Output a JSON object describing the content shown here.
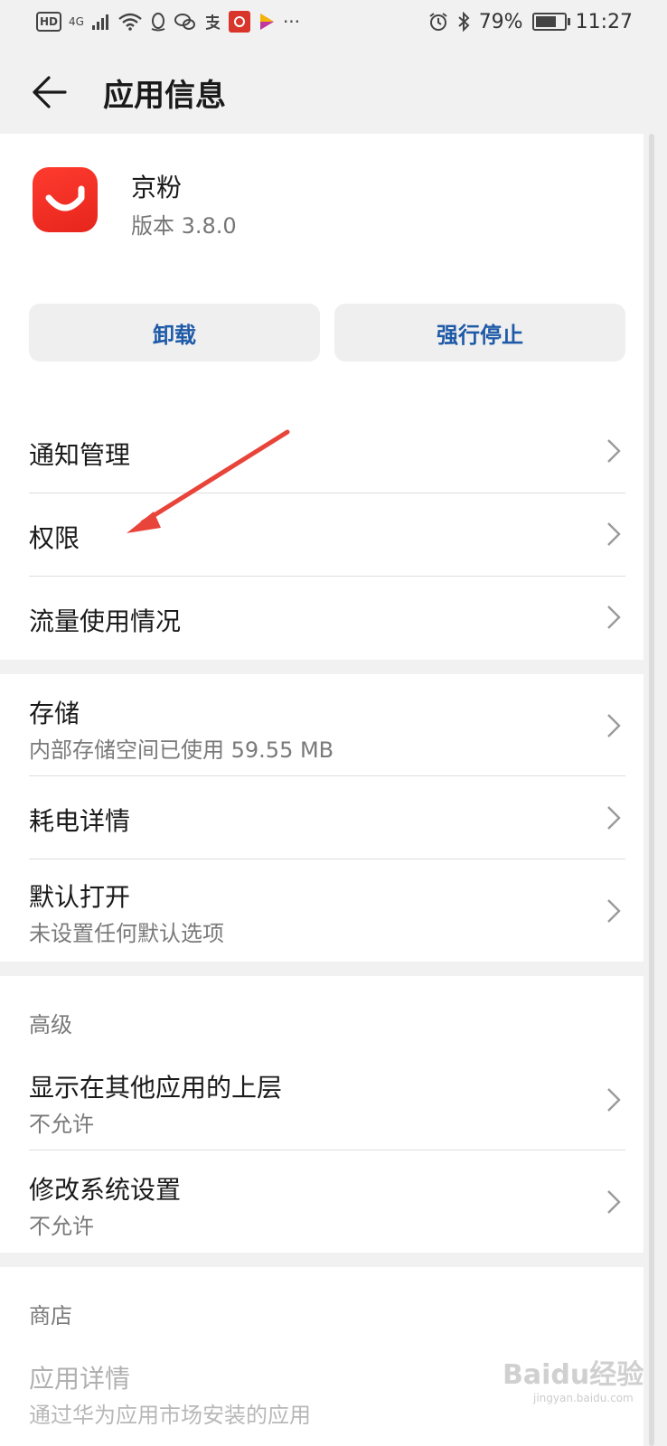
{
  "status_bar": {
    "network_badge": "HD",
    "network_type": "4G",
    "battery": "79%",
    "battery_level": 0.79,
    "time": "11:27",
    "more": "···"
  },
  "header": {
    "title": "应用信息"
  },
  "app": {
    "name": "京粉",
    "version": "版本 3.8.0"
  },
  "buttons": {
    "uninstall": "卸载",
    "force_stop": "强行停止"
  },
  "group1": [
    {
      "title": "通知管理"
    },
    {
      "title": "权限"
    },
    {
      "title": "流量使用情况"
    }
  ],
  "group2": [
    {
      "title": "存储",
      "subtitle": "内部存储空间已使用 59.55 MB"
    },
    {
      "title": "耗电详情"
    },
    {
      "title": "默认打开",
      "subtitle": "未设置任何默认选项"
    }
  ],
  "advanced": {
    "header": "高级",
    "items": [
      {
        "title": "显示在其他应用的上层",
        "subtitle": "不允许"
      },
      {
        "title": "修改系统设置",
        "subtitle": "不允许"
      }
    ]
  },
  "store": {
    "header": "商店",
    "items": [
      {
        "title": "应用详情",
        "subtitle": "通过华为应用市场安装的应用"
      }
    ]
  },
  "watermark": {
    "text": "Baidu经验",
    "url": "jingyan.baidu.com"
  },
  "colors": {
    "accent_blue": "#1e5aa8",
    "annotation_red": "#e8443a",
    "app_icon_red": "#ff3b2f"
  }
}
